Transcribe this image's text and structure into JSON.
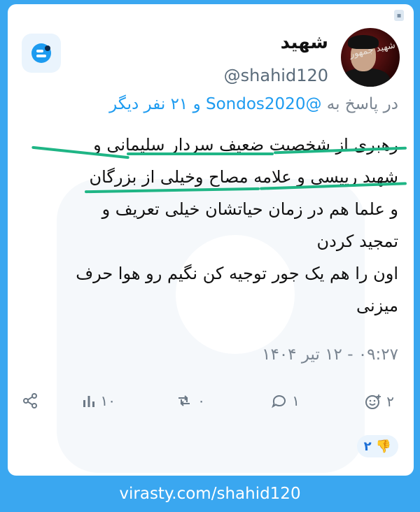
{
  "author": {
    "display_name": "شهید",
    "handle": "@shahid120",
    "avatar_caption": "شهید جمهور"
  },
  "reply": {
    "prefix": "در پاسخ به",
    "mention": "@Sondos2020",
    "suffix": "و ۲۱ نفر دیگر"
  },
  "tweet": {
    "lines": [
      "رهبری از شخصیت ضعیف سردار سلیمانی و",
      "شهید رییسی و علامه مصاح وخیلی از بزرگان",
      "و علما هم در زمان حیاتشان خیلی تعریف و",
      "تمجید کردن",
      "اون را هم یک جور توجیه کن نگیم رو هوا حرف",
      "میزنی"
    ],
    "timestamp": "۰۹:۲۷ - ۱۲ تیر ۱۴۰۴"
  },
  "actions": {
    "react_count": "۲",
    "reply_count": "۱",
    "repost_count": "۰",
    "views_count": "۱۰"
  },
  "reaction": {
    "emoji": "👎",
    "count": "۲"
  },
  "footer": {
    "url": "virasty.com/shahid120"
  },
  "colors": {
    "background": "#3aa7f0",
    "accent": "#1d9bf0",
    "underline": "#1fb585",
    "muted": "#7a8591"
  }
}
